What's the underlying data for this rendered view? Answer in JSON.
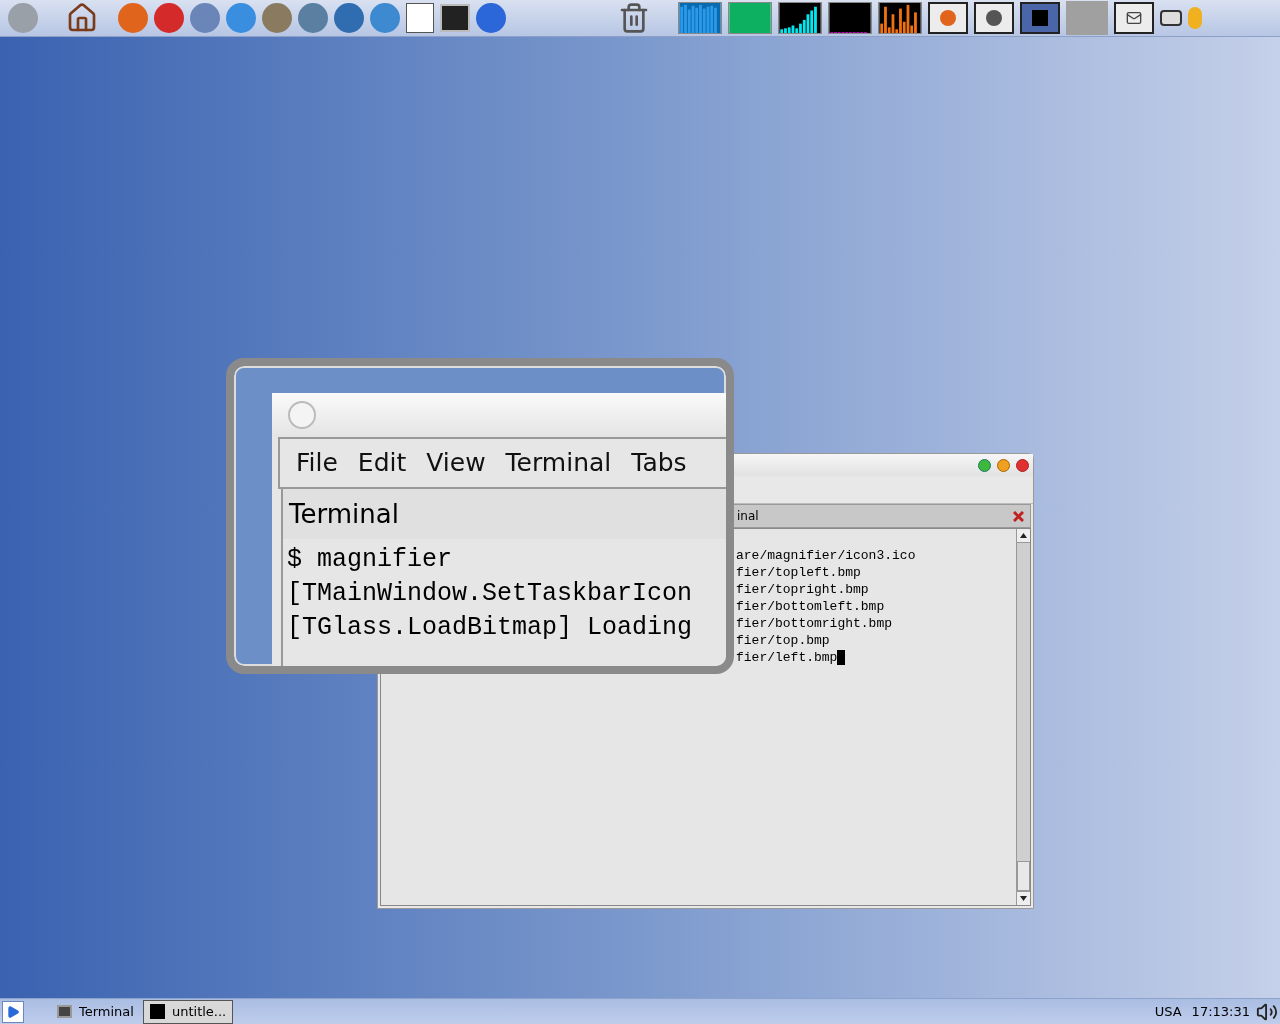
{
  "terminal_window": {
    "tab_title": "inal",
    "lines": [
      "are/magnifier/icon3.ico",
      "fier/topleft.bmp",
      "fier/topright.bmp",
      "fier/bottomleft.bmp",
      "fier/bottomright.bmp",
      "fier/top.bmp",
      "fier/left.bmp"
    ]
  },
  "magnifier": {
    "menu": [
      "File",
      "Edit",
      "View",
      "Terminal",
      "Tabs"
    ],
    "tab_title": "Terminal",
    "lines": [
      "$ magnifier",
      "[TMainWindow.SetTaskbarIcon",
      "[TGlass.LoadBitmap] Loading"
    ]
  },
  "taskbar": {
    "tasks": [
      {
        "label": "Terminal",
        "selected": false
      },
      {
        "label": "untitle...",
        "selected": true
      }
    ],
    "keyboard": "USA",
    "clock": "17:13:31"
  }
}
